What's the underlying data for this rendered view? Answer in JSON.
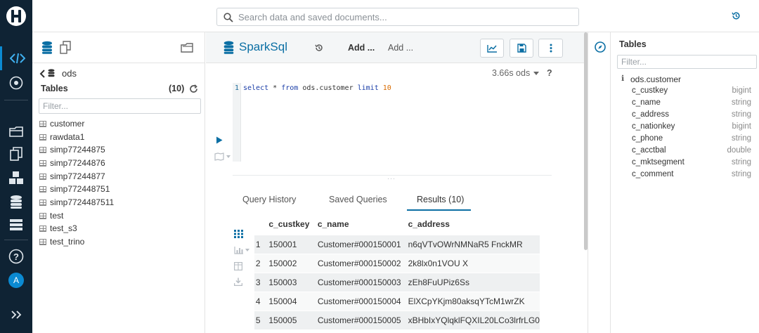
{
  "topbar": {
    "search_placeholder": "Search data and saved documents..."
  },
  "assist": {
    "database": "ods",
    "tables_label": "Tables",
    "tables_count": "(10)",
    "filter_placeholder": "Filter...",
    "tables": [
      "customer",
      "rawdata1",
      "simp77244875",
      "simp77244876",
      "simp77244877",
      "simp772448751",
      "simp7724487511",
      "test",
      "test_s3",
      "test_trino"
    ]
  },
  "editor": {
    "title": "SparkSql",
    "add1": "Add ...",
    "add2": "Add ...",
    "duration": "3.66s ods",
    "help": "?",
    "line_number": "1",
    "code": {
      "select": "select",
      "star": "*",
      "from": "from",
      "table": "ods.customer",
      "limit": "limit",
      "num": "10"
    }
  },
  "result_tabs": {
    "history": "Query History",
    "saved": "Saved Queries",
    "results": "Results (10)"
  },
  "results": {
    "headers": [
      "c_custkey",
      "c_name",
      "c_address"
    ],
    "rows": [
      [
        "1",
        "150001",
        "Customer#000150001",
        "n6qVTvOWrNMNaR5 FnckMR"
      ],
      [
        "2",
        "150002",
        "Customer#000150002",
        "2k8lx0n1VOU X"
      ],
      [
        "3",
        "150003",
        "Customer#000150003",
        "zEh8FuUPiz6Ss"
      ],
      [
        "4",
        "150004",
        "Customer#000150004",
        "ElXCpYKjm80aksqYTcM1wrZK"
      ],
      [
        "5",
        "150005",
        "Customer#000150005",
        "xBHbIxYQlqklFQXIL20LCo3lrfrLG0"
      ]
    ]
  },
  "right_panel": {
    "title": "Tables",
    "filter_placeholder": "Filter...",
    "table_name": "ods.customer",
    "columns": [
      {
        "name": "c_custkey",
        "type": "bigint"
      },
      {
        "name": "c_name",
        "type": "string"
      },
      {
        "name": "c_address",
        "type": "string"
      },
      {
        "name": "c_nationkey",
        "type": "bigint"
      },
      {
        "name": "c_phone",
        "type": "string"
      },
      {
        "name": "c_acctbal",
        "type": "double"
      },
      {
        "name": "c_mktsegment",
        "type": "string"
      },
      {
        "name": "c_comment",
        "type": "string"
      }
    ]
  },
  "user": {
    "avatar_letter": "A"
  },
  "colors": {
    "nav_bg": "#0f2334",
    "accent": "#0b6fa4",
    "active": "#3fb0ef"
  }
}
